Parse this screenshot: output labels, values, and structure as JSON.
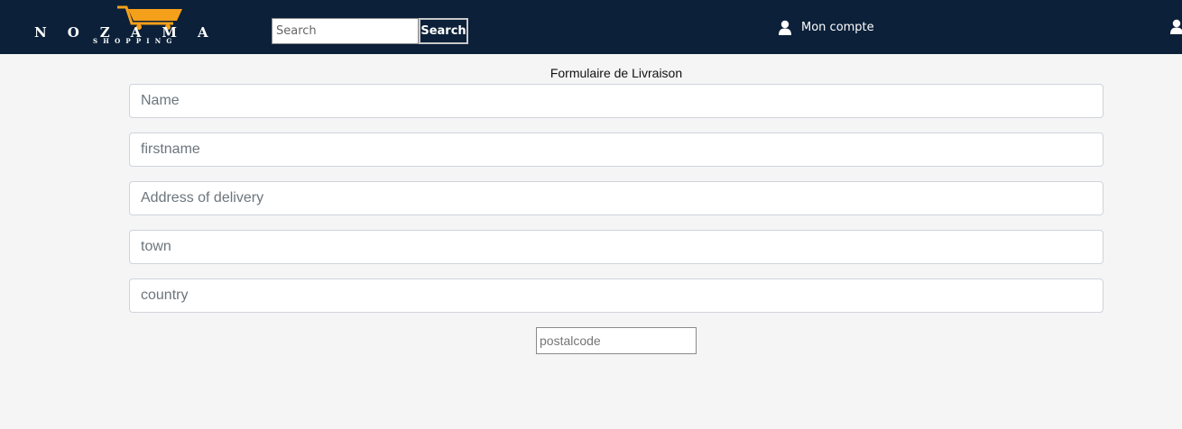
{
  "header": {
    "logo": {
      "name": "NOZAMA",
      "subtitle": "SHOPPING",
      "accent_color": "#f5a01a"
    },
    "background_color": "#0c2039",
    "search": {
      "placeholder": "Search",
      "value": "",
      "button_label": "Search"
    },
    "account": {
      "label": "Mon compte",
      "icon": "user-icon"
    },
    "right_icon": "user-icon"
  },
  "form": {
    "title": "Formulaire de Livraison",
    "fields": [
      {
        "placeholder": "Name",
        "value": ""
      },
      {
        "placeholder": "firstname",
        "value": ""
      },
      {
        "placeholder": "Address of delivery",
        "value": ""
      },
      {
        "placeholder": "town",
        "value": ""
      },
      {
        "placeholder": "country",
        "value": ""
      }
    ],
    "postalcode": {
      "placeholder": "postalcode",
      "value": ""
    }
  }
}
